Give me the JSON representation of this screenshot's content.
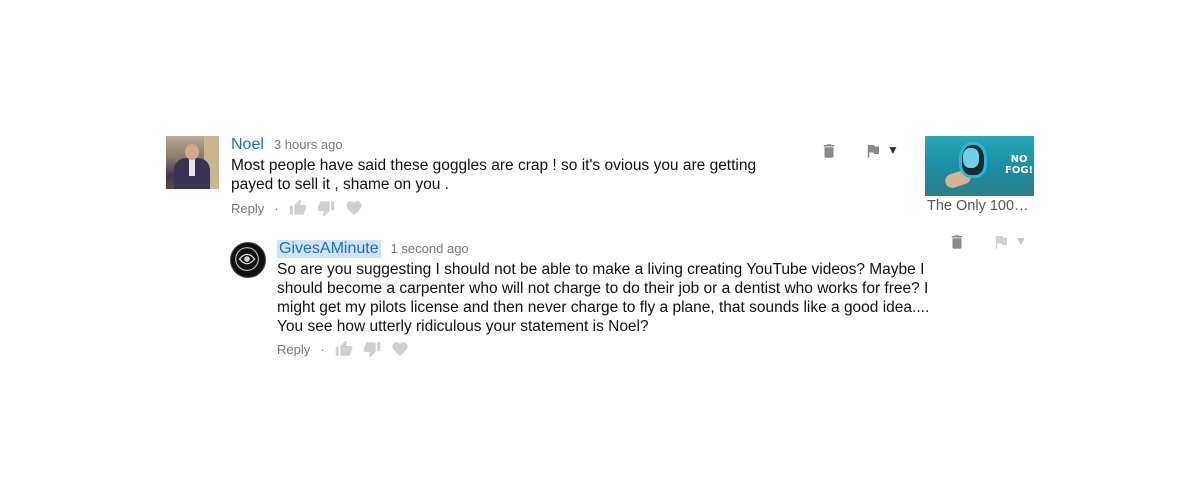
{
  "comments": [
    {
      "author": "Noel",
      "time": "3 hours ago",
      "text_lines": [
        "Most people have said these goggles are crap ! so it's ovious you are getting",
        "payed to sell it , shame on you ."
      ],
      "reply_label": "Reply",
      "separator": "·"
    },
    {
      "author": "GivesAMinute",
      "time": "1 second ago",
      "text_lines": [
        "So are you suggesting I should not be able to make a living creating YouTube videos? Maybe I",
        "should become a carpenter who will not charge to do their job or a dentist who works for free? I",
        "might get my pilots license and then never charge to fly a plane, that sounds like a good idea....",
        "You see how utterly ridiculous your statement is Noel?"
      ],
      "reply_label": "Reply",
      "separator": "·"
    }
  ],
  "sidebar_video": {
    "title": "The Only 100% ...",
    "thumbnail_text_line1": "NO",
    "thumbnail_text_line2": "FOG!"
  },
  "colors": {
    "author": "#1a6fc4",
    "icon_gray": "#8a8a8a",
    "icon_light": "#cfcfcf"
  }
}
